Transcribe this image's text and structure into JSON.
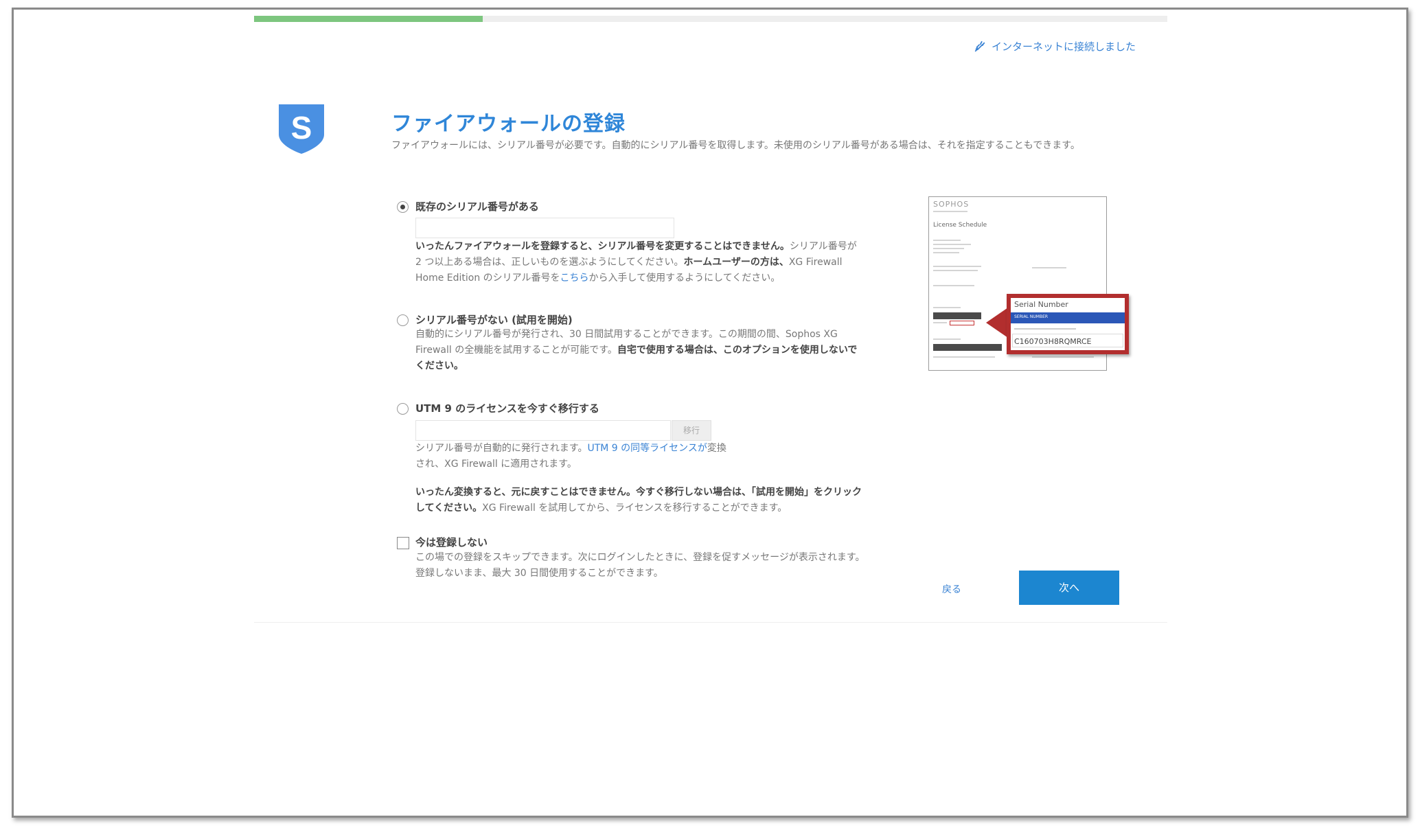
{
  "progress": {
    "fraction": 0.25,
    "fill_color": "#7dc67f"
  },
  "connection_status": {
    "icon": "plug-connected-icon",
    "text": "インターネットに接続しました"
  },
  "logo": {
    "letter": "S",
    "color": "#4a90e2"
  },
  "header": {
    "title": "ファイアウォールの登録",
    "subtitle": "ファイアウォールには、シリアル番号が必要です。自動的にシリアル番号を取得します。未使用のシリアル番号がある場合は、それを指定することもできます。"
  },
  "options": {
    "existing": {
      "label": "既存のシリアル番号がある",
      "checked": true,
      "input_value": "",
      "note_bold": "いったんファイアウォールを登録すると、シリアル番号を変更することはできません。",
      "note_text": "シリアル番号が 2 つ以上ある場合は、正しいものを選ぶようにしてください。",
      "note_bold2": "ホームユーザーの方は、",
      "note_text2": "XG Firewall Home Edition のシリアル番号を",
      "note_link": "こちら",
      "note_text3": "から入手して使用するようにしてください。"
    },
    "trial": {
      "label": "シリアル番号がない (試用を開始)",
      "checked": false,
      "desc_text": "自動的にシリアル番号が発行され、30 日間試用することができます。この期間の間、Sophos XG Firewall の全機能を試用することが可能です。",
      "desc_bold": "自宅で使用する場合は、このオプションを使用しないでください。"
    },
    "utm": {
      "label": "UTM 9 のライセンスを今すぐ移行する",
      "checked": false,
      "input_value": "",
      "button_label": "移行",
      "desc_text1": "シリアル番号が自動的に発行されます。",
      "desc_link": "UTM 9 の同等ライセンスが",
      "desc_text2": "変換され、XG Firewall に適用されます。",
      "warning_bold": "いったん変換すると、元に戻すことはできません。今すぐ移行しない場合は、「試用を開始」をクリックしてください。",
      "warning_text": "XG Firewall を試用してから、ライセンスを移行することができます。"
    },
    "skip": {
      "label": "今は登録しない",
      "checked": false,
      "desc_text": "この場での登録をスキップできます。次にログインしたときに、登録を促すメッセージが表示されます。登録しないまま、最大 30 日間使用することができます。"
    }
  },
  "license_image": {
    "brand": "SOPHOS",
    "doc_title": "License Schedule",
    "callout_label": "Serial Number",
    "callout_bar_text": "SERIAL NUMBER",
    "serial": "C160703H8RQMRCE"
  },
  "actions": {
    "back_label": "戻る",
    "next_label": "次へ"
  }
}
